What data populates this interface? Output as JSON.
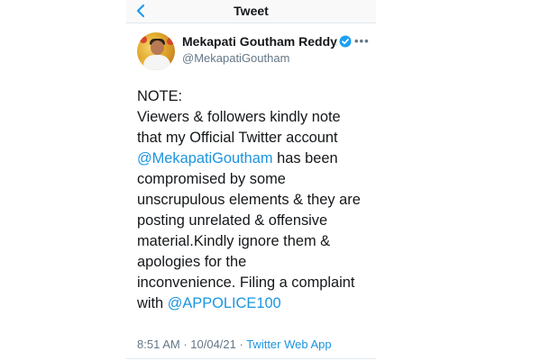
{
  "nav": {
    "title": "Tweet",
    "back_icon": "chevron-left-icon"
  },
  "author": {
    "name": "Mekapati Goutham Reddy...",
    "handle": "@MekapatiGoutham",
    "verified_icon": "verified-badge-icon",
    "more_icon": "more-horizontal-icon",
    "more_label": "•••"
  },
  "tweet": {
    "line1": "NOTE:",
    "line2": "Viewers & followers kindly note",
    "line3": "that my Official Twitter account",
    "mention1": "@MekapatiGoutham",
    "line4_after": " has been",
    "line5": "compromised by some",
    "line6": "unscrupulous elements & they are",
    "line7": "posting unrelated & offensive",
    "line8": "material.Kindly ignore them &",
    "line9": "apologies for the",
    "line10": "inconvenience. Filing a complaint",
    "line11_before": "with ",
    "mention2": "@APPOLICE100"
  },
  "meta": {
    "time": "8:51 AM",
    "separator": " · ",
    "date": "10/04/21",
    "separator2": " · ",
    "source": "Twitter Web App"
  },
  "colors": {
    "link": "#1b95e0",
    "verified": "#1da1f2",
    "muted": "#657786"
  }
}
